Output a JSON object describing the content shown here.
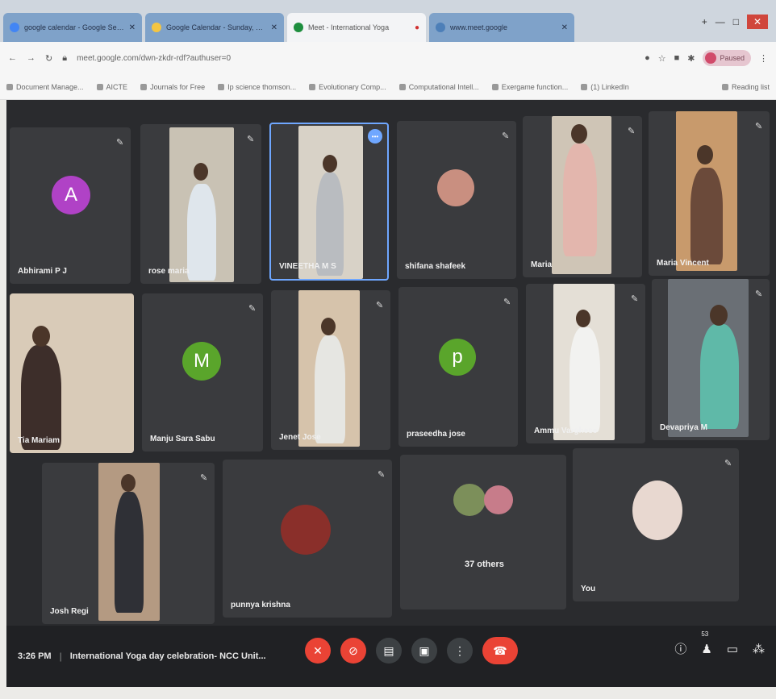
{
  "browser": {
    "tabs": [
      {
        "label": "google calendar - Google Search"
      },
      {
        "label": "Google Calendar - Sunday, June"
      },
      {
        "label": "Meet - International Yoga"
      },
      {
        "label": "www.meet.google"
      }
    ],
    "url": "meet.google.com/dwn-zkdr-rdf?authuser=0",
    "profile_label": "Paused",
    "bookmarks": [
      "Document Manage...",
      "AICTE",
      "Journals for Free",
      "Ip science thomson...",
      "Evolutionary Comp...",
      "Computational Intell...",
      "Exergame function...",
      "(1) LinkedIn"
    ],
    "reading_list": "Reading list"
  },
  "meet": {
    "participants": [
      {
        "name": "Abhirami P J",
        "initial": "A",
        "color": "#b042c6"
      },
      {
        "name": "rose maria"
      },
      {
        "name": "VINEETHA M S"
      },
      {
        "name": "shifana shafeek"
      },
      {
        "name": "Maria"
      },
      {
        "name": "Maria Vincent"
      },
      {
        "name": "Tia Mariam"
      },
      {
        "name": "Manju Sara Sabu",
        "initial": "M",
        "color": "#5aa52b"
      },
      {
        "name": "Jenet Jose"
      },
      {
        "name": "praseedha jose",
        "initial": "p",
        "color": "#5aa52b"
      },
      {
        "name": "Ammu Varghese"
      },
      {
        "name": "Devapriya M"
      },
      {
        "name": "Josh Regi"
      },
      {
        "name": "punnya krishna"
      },
      {
        "name": "37 others"
      },
      {
        "name": "You"
      }
    ],
    "active_speaker_badge": "•••",
    "bottom": {
      "time": "3:26 PM",
      "separator": "|",
      "meeting_title": "International Yoga day celebration- NCC Unit...",
      "participant_count": "53"
    }
  }
}
